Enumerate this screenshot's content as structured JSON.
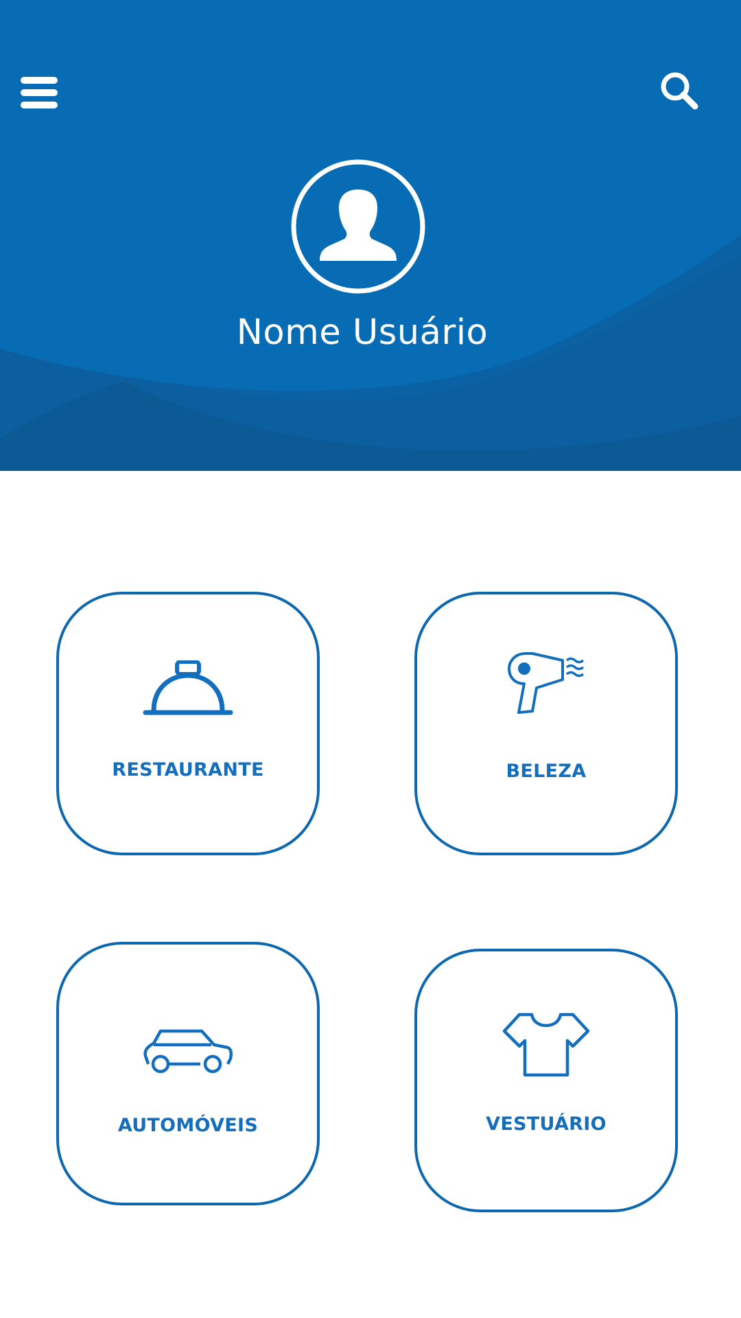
{
  "header": {
    "user_name": "Nome Usuário",
    "menu_icon": "hamburger-menu-icon",
    "search_icon": "search-icon",
    "avatar_icon": "user-silhouette-icon"
  },
  "categories": [
    {
      "label": "RESTAURANTE",
      "icon": "food-cloche-icon"
    },
    {
      "label": "BELEZA",
      "icon": "hair-dryer-icon"
    },
    {
      "label": "AUTOMÓVEIS",
      "icon": "car-icon"
    },
    {
      "label": "VESTUÁRIO",
      "icon": "t-shirt-icon"
    }
  ],
  "colors": {
    "header_blue": "#086cb4",
    "header_wave_dark": "#0b5c96",
    "accent_blue": "#136fbd",
    "card_border": "#0e68b0",
    "background": "#ffffff"
  }
}
